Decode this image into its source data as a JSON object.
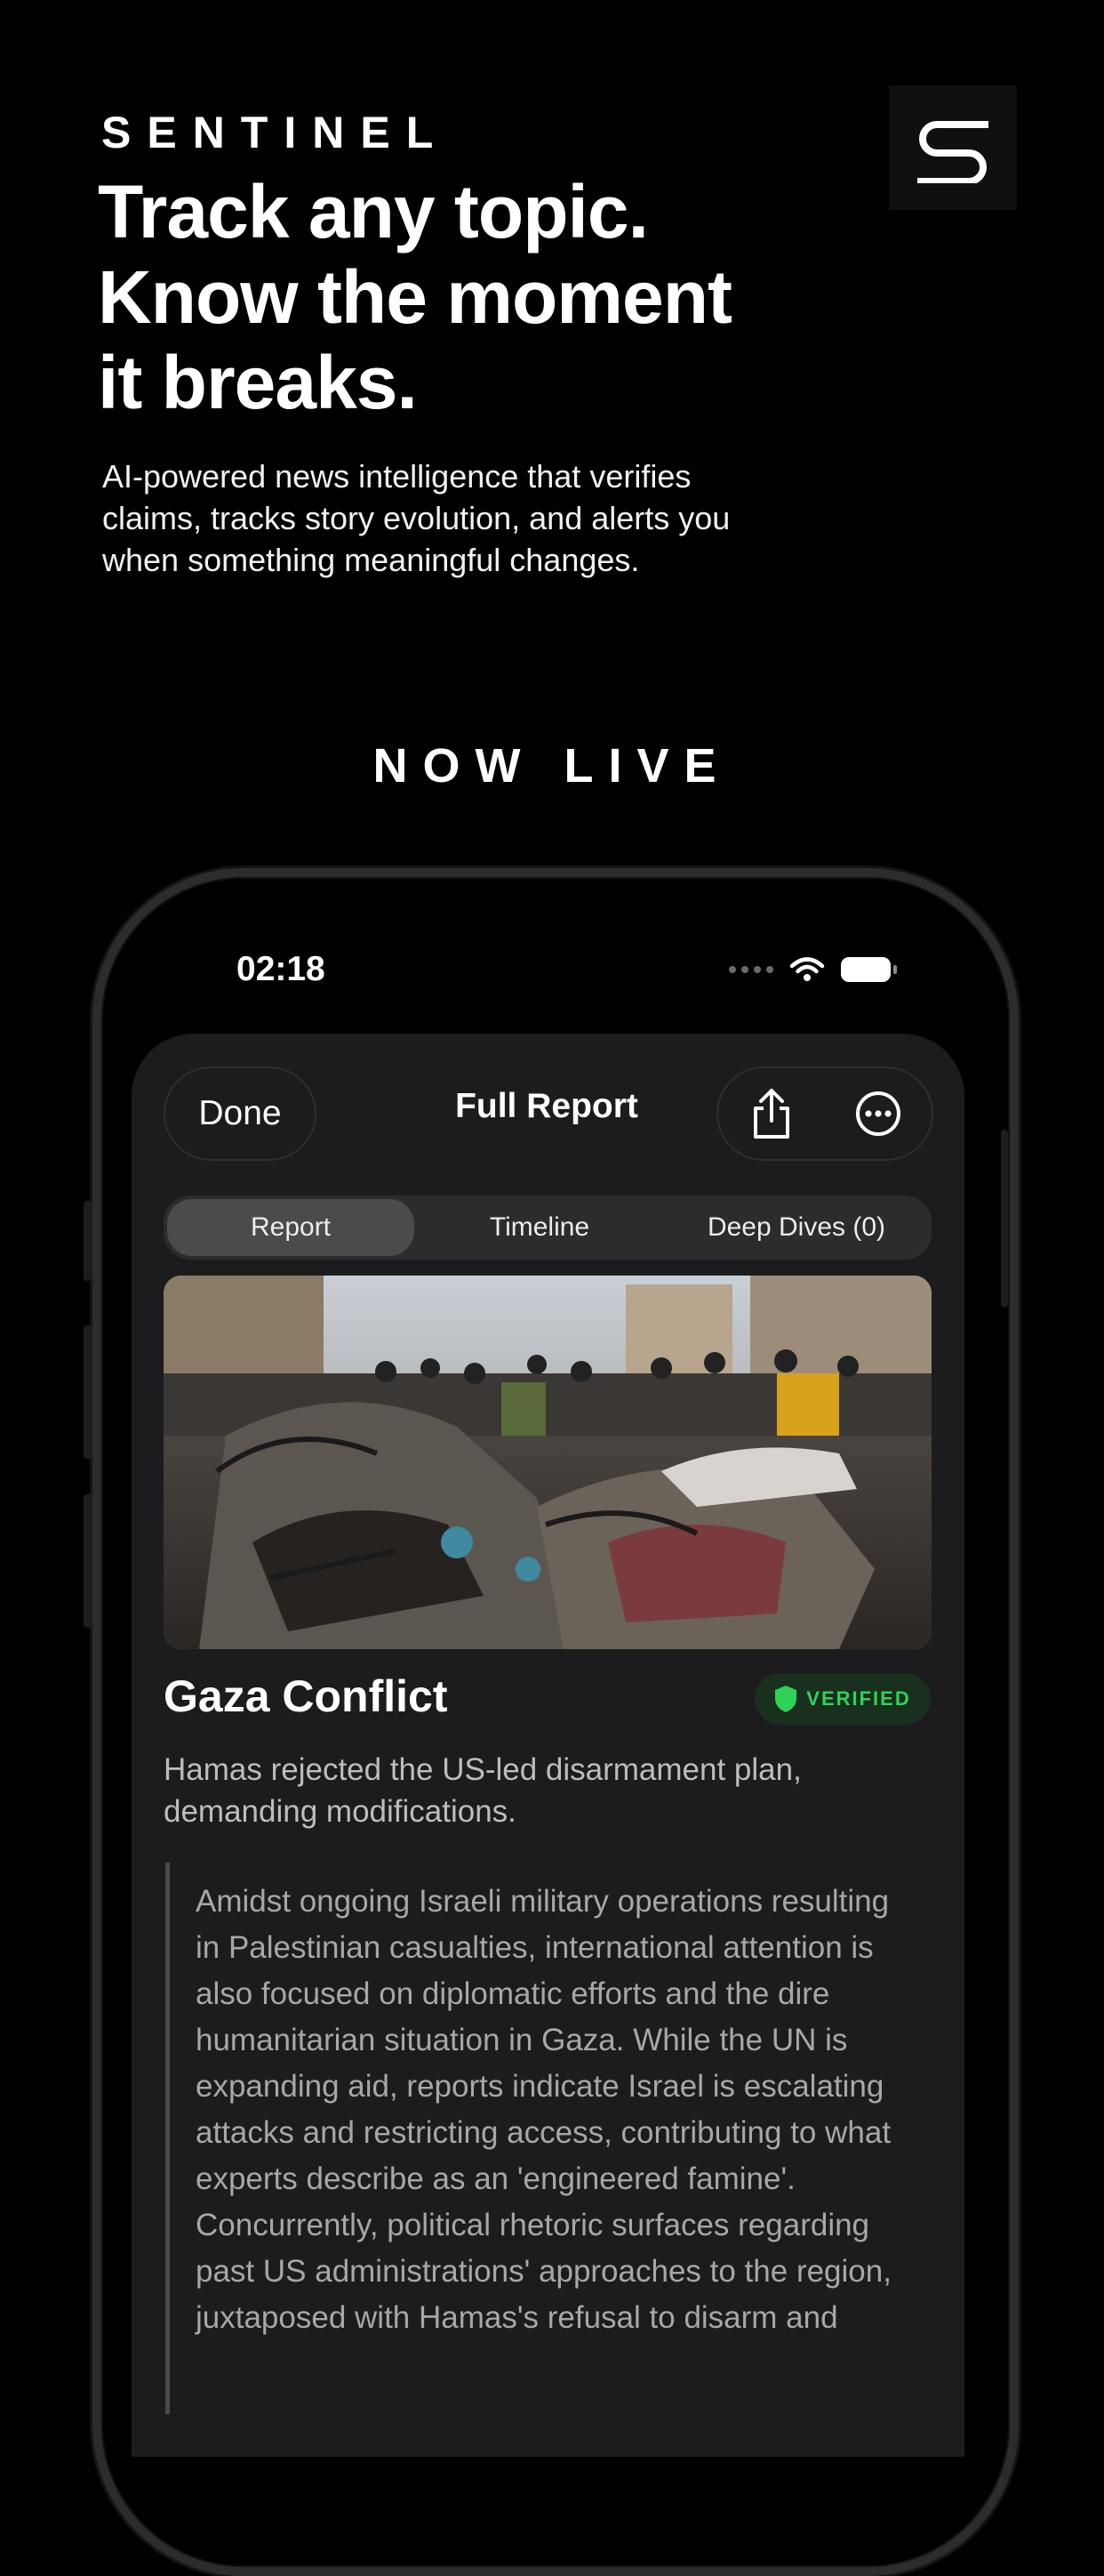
{
  "promo": {
    "brand": "SENTINEL",
    "headline": [
      "Track any topic.",
      "Know the moment",
      "it breaks."
    ],
    "subtitle": "AI-powered news intelligence that verifies claims, tracks story evolution, and alerts you when something meaningful changes.",
    "now_live": "NOW LIVE",
    "logo_icon": "s-logo-icon"
  },
  "status_bar": {
    "time": "02:18",
    "icons": [
      "signal-dots-icon",
      "wifi-icon",
      "battery-icon"
    ]
  },
  "nav": {
    "done_label": "Done",
    "title": "Full Report",
    "actions": [
      "share-icon",
      "more-icon"
    ]
  },
  "tabs": [
    {
      "label": "Report",
      "active": true
    },
    {
      "label": "Timeline",
      "active": false
    },
    {
      "label": "Deep Dives (0)",
      "active": false
    }
  ],
  "report": {
    "topic": "Gaza Conflict",
    "badge": "VERIFIED",
    "badge_color": "#30d158",
    "summary": "Hamas rejected the US-led disarmament plan, demanding modifications.",
    "body": "Amidst ongoing Israeli military operations resulting in Palestinian casualties, international attention is also focused on diplomatic efforts and the dire humanitarian situation in Gaza. While the UN is expanding aid, reports indicate Israel is escalating attacks and restricting access, contributing to what experts describe as an 'engineered famine'. Concurrently, political rhetoric surfaces regarding past US administrations' approaches to the region, juxtaposed with Hamas's refusal to disarm and"
  },
  "colors": {
    "background": "#000000",
    "sheet": "#1c1c1e",
    "verified_green": "#30d158"
  }
}
